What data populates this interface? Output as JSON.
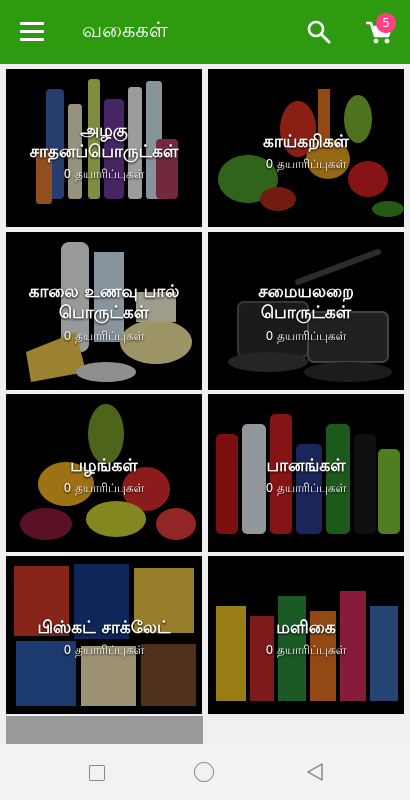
{
  "appbar": {
    "title": "வகைகள்",
    "cart_count": "5",
    "icons": [
      "menu-icon",
      "search-icon",
      "cart-icon"
    ],
    "color": "#2e9a0f",
    "badge_color": "#ff4081"
  },
  "categories": [
    {
      "label_lines": [
        "அழகு",
        "சாதனப்பொருட்கள்"
      ],
      "count": "0 தயாரிப்புகள்"
    },
    {
      "label_lines": [
        "காய்கறிகள்"
      ],
      "count": "0 தயாரிப்புகள்"
    },
    {
      "label_lines": [
        "காலை உணவு பால்",
        "பொருட்கள்"
      ],
      "count": "0 தயாரிப்புகள்"
    },
    {
      "label_lines": [
        "சமையலறை",
        "பொருட்கள்"
      ],
      "count": "0 தயாரிப்புகள்"
    },
    {
      "label_lines": [
        "பழங்கள்"
      ],
      "count": "0 தயாரிப்புகள்"
    },
    {
      "label_lines": [
        "பானங்கள்"
      ],
      "count": "0 தயாரிப்புகள்"
    },
    {
      "label_lines": [
        "பிஸ்கட் சாக்லேட்"
      ],
      "count": "0 தயாரிப்புகள்"
    },
    {
      "label_lines": [
        "மளிகை"
      ],
      "count": "0 தயாரிப்புகள்"
    }
  ],
  "navbar": {
    "icons": [
      "recent-apps-icon",
      "home-icon",
      "back-icon"
    ]
  }
}
